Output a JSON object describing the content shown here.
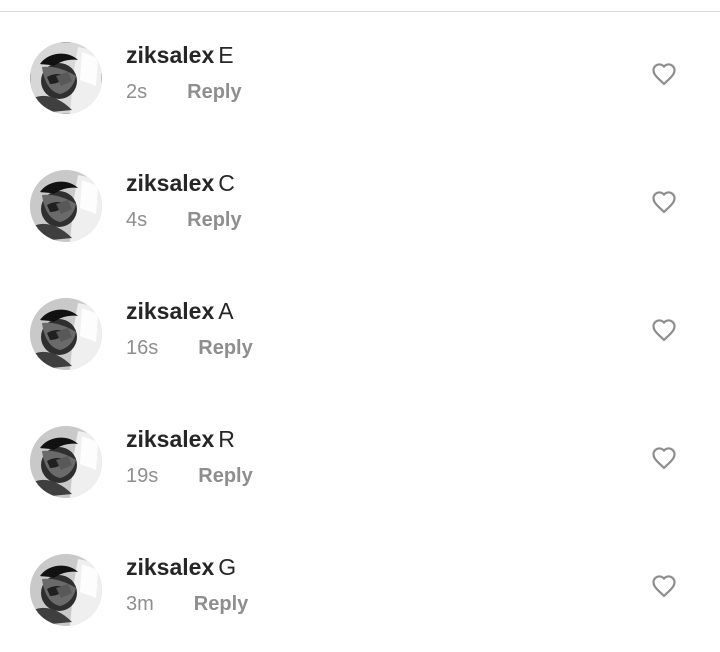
{
  "comments": [
    {
      "username": "ziksalex",
      "text": "E",
      "time": "2s",
      "reply_label": "Reply",
      "avatar_icon": "user-avatar",
      "like_icon": "heart-outline-icon"
    },
    {
      "username": "ziksalex",
      "text": "C",
      "time": "4s",
      "reply_label": "Reply",
      "avatar_icon": "user-avatar",
      "like_icon": "heart-outline-icon"
    },
    {
      "username": "ziksalex",
      "text": "A",
      "time": "16s",
      "reply_label": "Reply",
      "avatar_icon": "user-avatar",
      "like_icon": "heart-outline-icon"
    },
    {
      "username": "ziksalex",
      "text": "R",
      "time": "19s",
      "reply_label": "Reply",
      "avatar_icon": "user-avatar",
      "like_icon": "heart-outline-icon"
    },
    {
      "username": "ziksalex",
      "text": "G",
      "time": "3m",
      "reply_label": "Reply",
      "avatar_icon": "user-avatar",
      "like_icon": "heart-outline-icon"
    }
  ],
  "colors": {
    "primary_text": "#262626",
    "secondary_text": "#8e8e8e",
    "divider": "#dbdbdb",
    "background": "#ffffff"
  }
}
